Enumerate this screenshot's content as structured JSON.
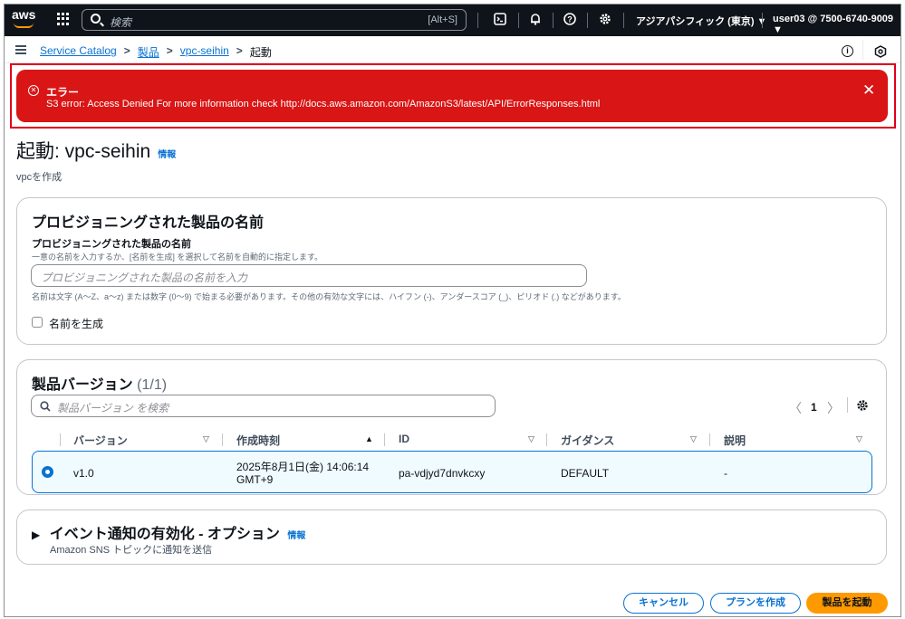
{
  "topnav": {
    "logo": "aws",
    "search_placeholder": "検索",
    "search_shortcut": "[Alt+S]",
    "icons": [
      "grid-icon",
      "cloudshell-icon",
      "bell-icon",
      "help-icon",
      "settings-icon"
    ],
    "region": "アジアパシフィック (東京) ▼",
    "account": "user03 @ 7500-6740-9009 ▼"
  },
  "breadcrumb": [
    {
      "label": "Service Catalog"
    },
    {
      "label": "製品"
    },
    {
      "label": "vpc-seihin"
    },
    {
      "label": "起動"
    }
  ],
  "alert": {
    "title": "エラー",
    "message": "S3 error: Access Denied For more information check http://docs.aws.amazon.com/AmazonS3/latest/API/ErrorResponses.html",
    "color": "#d91515"
  },
  "page": {
    "title": "起動: vpc-seihin",
    "info": "情報",
    "subtitle": "vpcを作成"
  },
  "name_section": {
    "heading": "プロビジョニングされた製品の名前",
    "label": "プロビジョニングされた製品の名前",
    "description": "一意の名前を入力するか、[名前を生成] を選択して名前を自動的に指定します。",
    "placeholder": "プロビジョニングされた製品の名前を入力",
    "constraint": "名前は文字 (A～Z、a～z) または数字 (0～9) で始まる必要があります。その他の有効な文字には、ハイフン (-)、アンダースコア (_)、ピリオド (.) などがあります。",
    "checkbox_label": "名前を生成"
  },
  "versions": {
    "heading": "製品バージョン",
    "count": "(1/1)",
    "search_placeholder": "製品バージョン を検索",
    "page": "1",
    "columns": [
      "バージョン",
      "作成時刻",
      "ID",
      "ガイダンス",
      "説明"
    ],
    "rows": [
      {
        "version": "v1.0",
        "created_line1": "2025年8月1日(金) 14:06:14",
        "created_line2": "GMT+9",
        "id": "pa-vdjyd7dnvkcxy",
        "guidance": "DEFAULT",
        "description": "-",
        "selected": true
      }
    ]
  },
  "events": {
    "heading": "イベント通知の有効化 - オプション",
    "info": "情報",
    "description": "Amazon SNS トピックに通知を送信"
  },
  "footer": {
    "cancel": "キャンセル",
    "plan": "プランを作成",
    "launch": "製品を起動"
  },
  "colors": {
    "accent": "#0972d3",
    "primary_button": "#ff9900",
    "nav_bg": "#0f141a"
  }
}
